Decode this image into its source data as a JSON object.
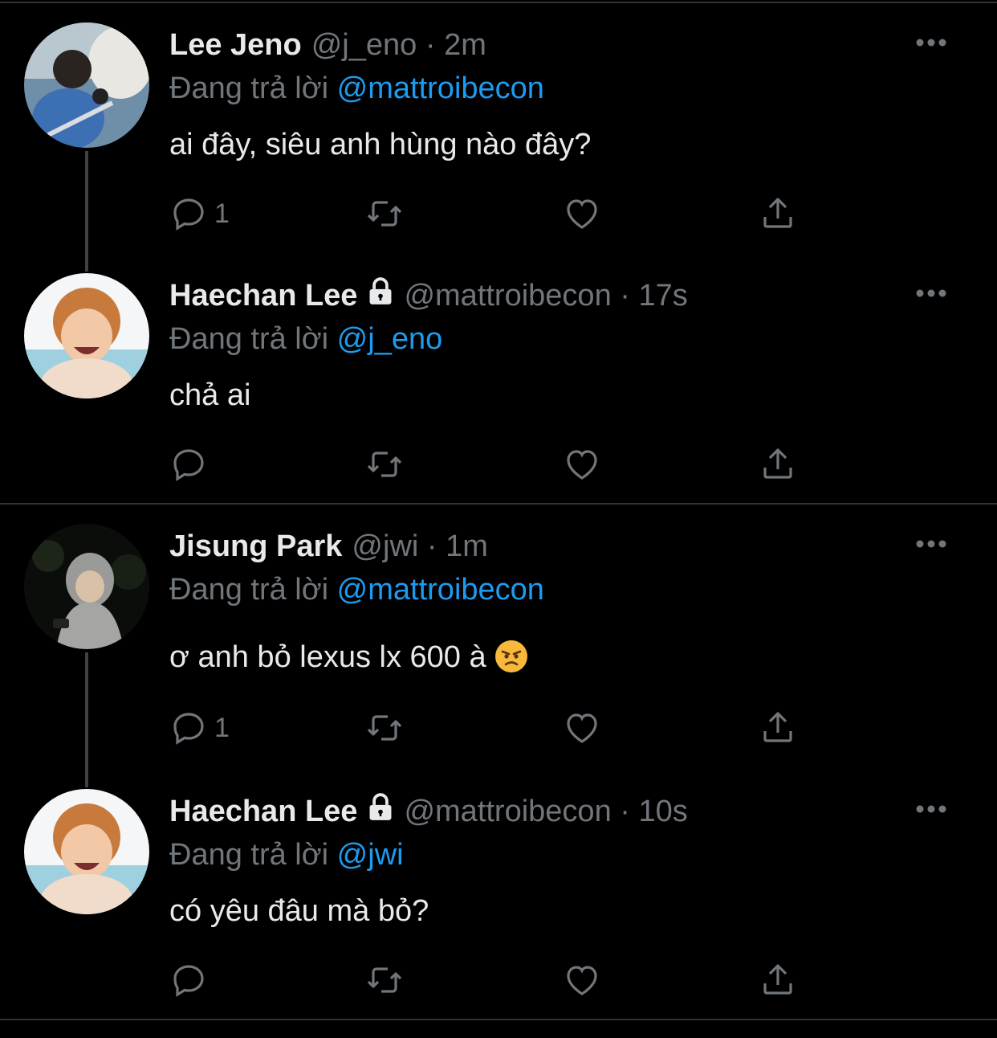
{
  "labels": {
    "replying_prefix": "Đang trả lời"
  },
  "colors": {
    "background": "#000000",
    "text": "#e7e9ea",
    "secondary": "#71767b",
    "accent": "#1d9bf0",
    "divider": "#2f3336"
  },
  "tweets": [
    {
      "name": "Lee Jeno",
      "handle": "@j_eno",
      "separator": "·",
      "time": "2m",
      "protected": false,
      "replying_to": "@mattroibecon",
      "text": "ai đây, siêu anh hùng nào đây?",
      "emoji": "",
      "reply_count": "1",
      "avatar": "photo"
    },
    {
      "name": "Haechan Lee",
      "handle": "@mattroibecon",
      "separator": "·",
      "time": "17s",
      "protected": true,
      "replying_to": "@j_eno",
      "text": "chả ai",
      "emoji": "",
      "reply_count": "",
      "avatar": "photo"
    },
    {
      "name": "Jisung Park",
      "handle": "@jwi",
      "separator": "·",
      "time": "1m",
      "protected": false,
      "replying_to": "@mattroibecon",
      "text": "ơ anh bỏ lexus lx 600 à",
      "emoji": "angry-face",
      "reply_count": "1",
      "avatar": "photo"
    },
    {
      "name": "Haechan Lee",
      "handle": "@mattroibecon",
      "separator": "·",
      "time": "10s",
      "protected": true,
      "replying_to": "@jwi",
      "text": "có yêu đâu mà bỏ?",
      "emoji": "",
      "reply_count": "",
      "avatar": "photo"
    }
  ],
  "icons": {
    "reply": "reply-icon",
    "retweet": "retweet-icon",
    "like": "heart-icon",
    "share": "share-icon",
    "more": "more-icon",
    "lock": "lock-icon"
  }
}
